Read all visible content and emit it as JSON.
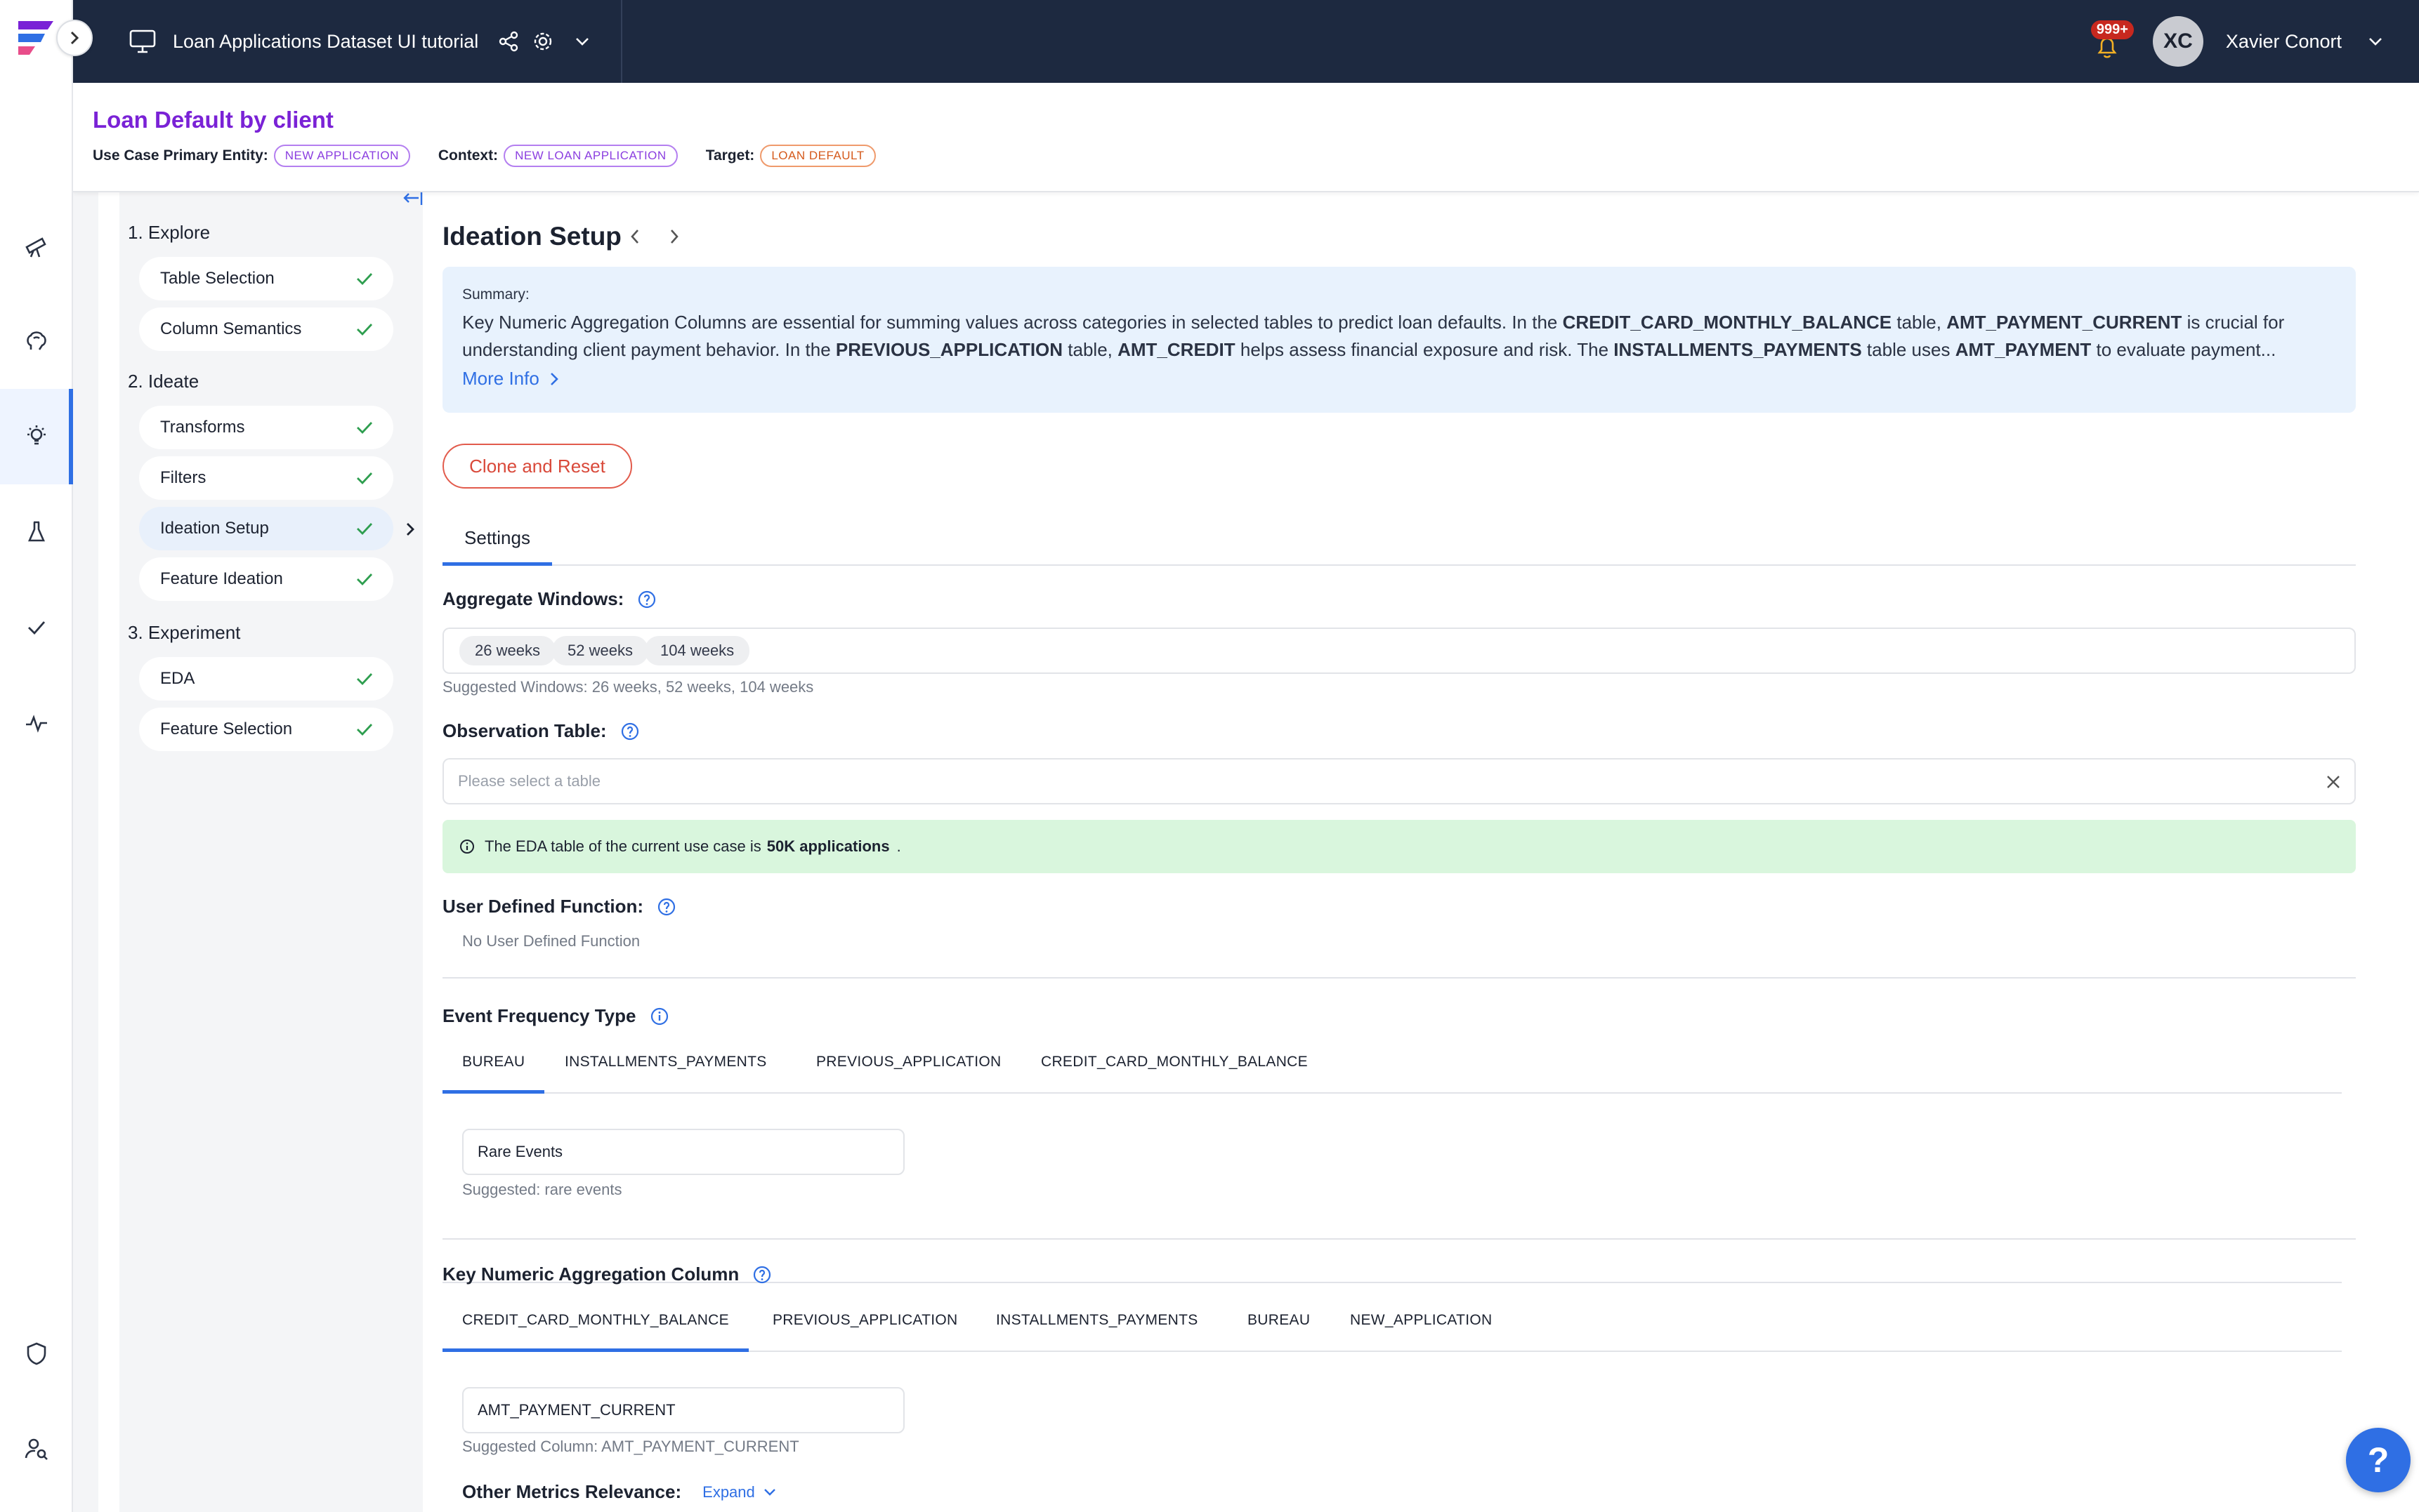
{
  "app": {
    "project_title": "Loan Applications Dataset UI tutorial",
    "notifications_badge": "999+",
    "user": {
      "initials": "XC",
      "name": "Xavier Conort"
    }
  },
  "use_case": {
    "title": "Loan Default by client",
    "primary_entity_label": "Use Case Primary Entity:",
    "primary_entity": "NEW APPLICATION",
    "context_label": "Context:",
    "context": "NEW LOAN APPLICATION",
    "target_label": "Target:",
    "target": "LOAN DEFAULT"
  },
  "rail_icons": [
    "catalog-telescope-icon",
    "brain-icon",
    "lightbulb-icon",
    "flask-icon",
    "check-icon",
    "pulse-icon",
    "shield-icon",
    "user-search-icon"
  ],
  "steps": {
    "explore": {
      "label": "1. Explore",
      "items": [
        {
          "label": "Table Selection"
        },
        {
          "label": "Column Semantics"
        }
      ]
    },
    "ideate": {
      "label": "2. Ideate",
      "items": [
        {
          "label": "Transforms"
        },
        {
          "label": "Filters"
        },
        {
          "label": "Ideation Setup"
        },
        {
          "label": "Feature Ideation"
        }
      ]
    },
    "experiment": {
      "label": "3. Experiment",
      "items": [
        {
          "label": "EDA"
        },
        {
          "label": "Feature Selection"
        }
      ]
    },
    "active": "Ideation Setup"
  },
  "main": {
    "title": "Ideation Setup",
    "summary": {
      "label": "Summary:",
      "parts": [
        "Key Numeric Aggregation Columns are essential for summing values across categories in selected tables to predict loan defaults. In the ",
        "CREDIT_CARD_MONTHLY_BALANCE",
        " table, ",
        "AMT_PAYMENT_CURRENT",
        " is crucial for understanding client payment behavior. In the ",
        "PREVIOUS_APPLICATION",
        " table, ",
        "AMT_CREDIT",
        " helps assess financial exposure and risk. The ",
        "INSTALLMENTS_PAYMENTS",
        " table uses ",
        "AMT_PAYMENT",
        " to evaluate payment..."
      ],
      "more_info": "More Info"
    },
    "clone_reset": "Clone and Reset",
    "tab_settings": "Settings",
    "aggregate_windows": {
      "label": "Aggregate Windows:",
      "chips": [
        "26 weeks",
        "52 weeks",
        "104 weeks"
      ],
      "hint": "Suggested Windows: 26 weeks, 52 weeks, 104 weeks"
    },
    "observation_table": {
      "label": "Observation Table:",
      "placeholder": "Please select a table"
    },
    "eda_alert": {
      "prefix": "The EDA table of the current use case is",
      "table": "50K applications",
      "suffix": "."
    },
    "udf": {
      "label": "User Defined Function:",
      "value": "No User Defined Function"
    },
    "event_frequency": {
      "label": "Event Frequency Type",
      "tabs": [
        "BUREAU",
        "INSTALLMENTS_PAYMENTS",
        "PREVIOUS_APPLICATION",
        "CREDIT_CARD_MONTHLY_BALANCE"
      ],
      "active": "BUREAU",
      "value": "Rare Events",
      "hint": "Suggested: rare events"
    },
    "key_numeric": {
      "label": "Key Numeric Aggregation Column",
      "tabs": [
        "CREDIT_CARD_MONTHLY_BALANCE",
        "PREVIOUS_APPLICATION",
        "INSTALLMENTS_PAYMENTS",
        "BUREAU",
        "NEW_APPLICATION"
      ],
      "active": "CREDIT_CARD_MONTHLY_BALANCE",
      "value": "AMT_PAYMENT_CURRENT",
      "hint": "Suggested Column: AMT_PAYMENT_CURRENT"
    },
    "other_metrics": {
      "label": "Other Metrics Relevance:",
      "expand": "Expand"
    }
  },
  "help_fab": "?",
  "colors": {
    "accent": "#2f6fe4",
    "header_bg": "#1d2940",
    "title_purple": "#7a22d6",
    "success_bg": "#d9f6dd",
    "danger": "#d9493a"
  }
}
